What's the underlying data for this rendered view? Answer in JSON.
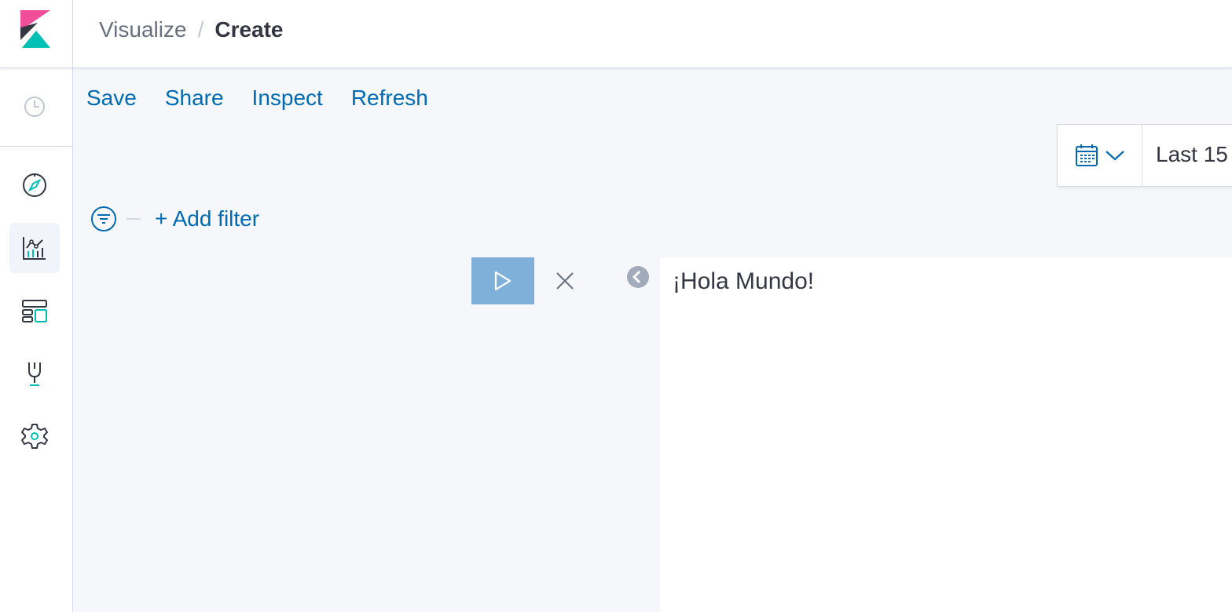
{
  "header": {
    "logo_icon": "kibana-logo-icon",
    "breadcrumbs": {
      "parent": "Visualize",
      "separator": "/",
      "current": "Create"
    }
  },
  "sidenav": {
    "recent_icon": "clock-icon",
    "items": [
      {
        "id": "discover",
        "icon": "compass-icon"
      },
      {
        "id": "visualize",
        "icon": "visualize-icon",
        "active": true
      },
      {
        "id": "dashboard",
        "icon": "dashboard-icon"
      },
      {
        "id": "dev-tools",
        "icon": "wrench-icon"
      },
      {
        "id": "management",
        "icon": "gear-icon"
      }
    ]
  },
  "topnav": {
    "save": "Save",
    "share": "Share",
    "inspect": "Inspect",
    "refresh": "Refresh"
  },
  "datepicker": {
    "icons": [
      "calendar-icon",
      "chevron-down-icon"
    ],
    "value": "Last 15"
  },
  "filterbar": {
    "icon": "filter-icon",
    "add_filter": "+ Add filter"
  },
  "editor": {
    "run_icon": "play-icon",
    "close_icon": "close-icon",
    "collapse_icon": "arrow-left-circle-icon"
  },
  "canvas": {
    "text": "¡Hola Mundo!"
  },
  "colors": {
    "link": "#006bb4",
    "accent": "#00bfb3",
    "brand_pink": "#f04e98",
    "run_button": "#7fb0d9",
    "border": "#d3dae6",
    "background": "#f5f7fa"
  }
}
